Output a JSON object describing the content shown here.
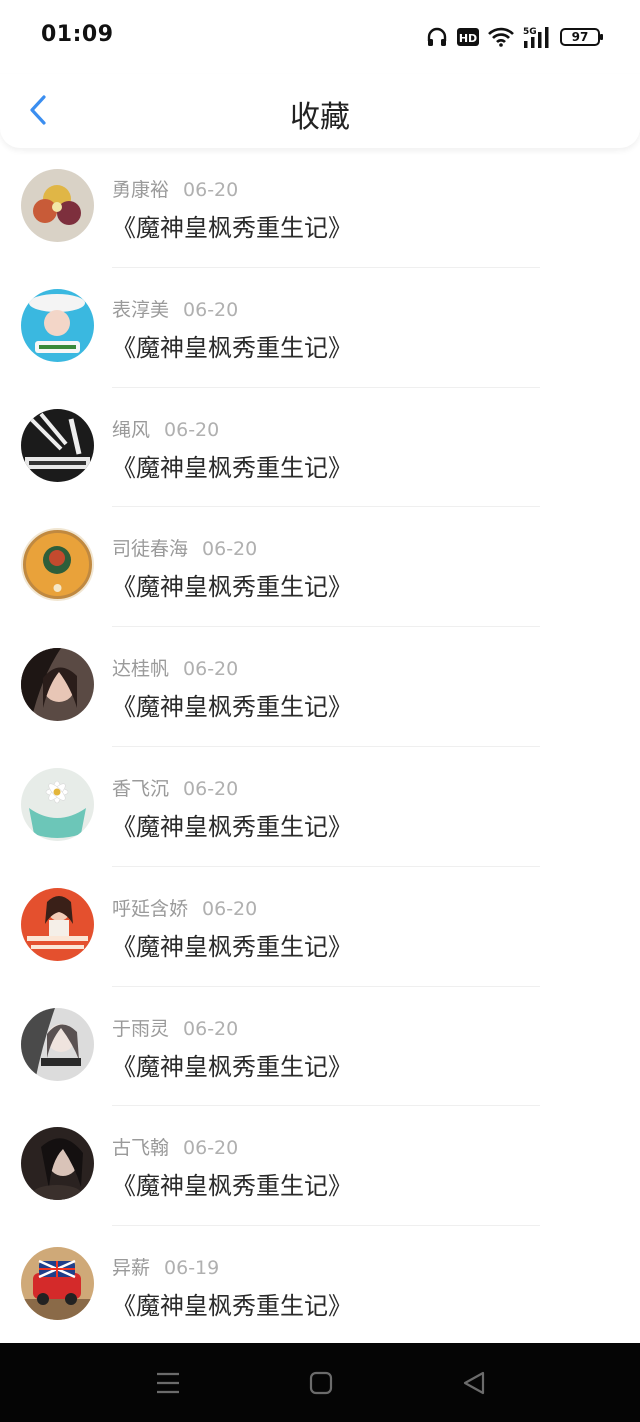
{
  "status_bar": {
    "time": "01:09",
    "hd_badge": "HD",
    "network": "5G",
    "battery": "97",
    "icons": [
      "headphones-icon",
      "hd-icon",
      "wifi-icon",
      "signal-5g-icon",
      "battery-icon"
    ]
  },
  "header": {
    "title": "收藏",
    "back_icon": "chevron-left-icon",
    "accent": "#3b8ef0"
  },
  "favorites": [
    {
      "user": "勇康裕",
      "date": "06-20",
      "book": "《魔神皇枫秀重生记》"
    },
    {
      "user": "表淳美",
      "date": "06-20",
      "book": "《魔神皇枫秀重生记》"
    },
    {
      "user": "绳风",
      "date": "06-20",
      "book": "《魔神皇枫秀重生记》"
    },
    {
      "user": "司徒春海",
      "date": "06-20",
      "book": "《魔神皇枫秀重生记》"
    },
    {
      "user": "达桂帆",
      "date": "06-20",
      "book": "《魔神皇枫秀重生记》"
    },
    {
      "user": "香飞沉",
      "date": "06-20",
      "book": "《魔神皇枫秀重生记》"
    },
    {
      "user": "呼延含娇",
      "date": "06-20",
      "book": "《魔神皇枫秀重生记》"
    },
    {
      "user": "于雨灵",
      "date": "06-20",
      "book": "《魔神皇枫秀重生记》"
    },
    {
      "user": "古飞翰",
      "date": "06-20",
      "book": "《魔神皇枫秀重生记》"
    },
    {
      "user": "异薪",
      "date": "06-19",
      "book": "《魔神皇枫秀重生记》"
    }
  ],
  "system_nav": [
    "menu-icon",
    "home-square-icon",
    "back-triangle-icon"
  ]
}
